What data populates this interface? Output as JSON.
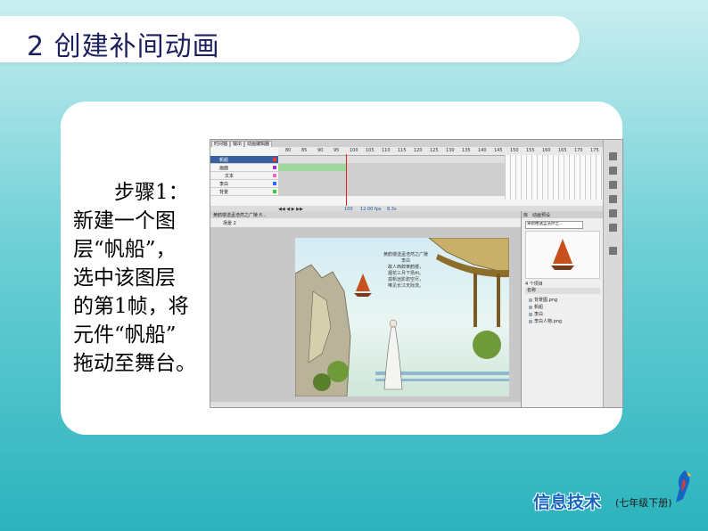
{
  "slide": {
    "title": "2 创建补间动画",
    "step_lines": [
      "步骤1：",
      "新建一个图",
      "层“帆船”，",
      "选中该图层",
      "的第1帧，将",
      "元件“帆船”",
      "拖动至舞台。"
    ]
  },
  "flash": {
    "timeline_tabs": [
      "时间轴",
      "输出",
      "动画编辑器"
    ],
    "ruler_marks": [
      "80",
      "85",
      "90",
      "95",
      "100",
      "105",
      "110",
      "115",
      "120",
      "125",
      "130",
      "135",
      "140",
      "145",
      "150",
      "155",
      "160",
      "165",
      "170",
      "175"
    ],
    "layers": [
      {
        "name": "帆船",
        "color": "#ff3333"
      },
      {
        "name": "画面",
        "color": "#9933cc"
      },
      {
        "name": "文本",
        "color": "#ff66cc"
      },
      {
        "name": "李白",
        "color": "#3366ff"
      },
      {
        "name": "背景",
        "color": "#33cc33"
      }
    ],
    "timeline_status": [
      "100",
      "12.00 fps",
      "8.3s"
    ],
    "document_tab": "黄鹤楼送孟浩然之广陵.fl...",
    "scene_label": "场景 2",
    "poem_lines": [
      "黄鹤楼送孟浩然之广陵",
      "李白",
      "故人西辞黄鹤楼，",
      "烟花三月下扬州。",
      "孤帆远影碧空尽，",
      "唯见长江天际流。"
    ],
    "panel_tabs": [
      "库",
      "动画预设"
    ],
    "library_select": "黄鹤楼送孟浩然之...",
    "library_count": "4 个项目",
    "library_header": "名称",
    "library_items": [
      "背景图.png",
      "帆船",
      "李白",
      "李白人物.png"
    ]
  },
  "branding": {
    "logo_title": "信息技术",
    "logo_subtitle": "(七年级下册)"
  },
  "colors": {
    "title_text": "#1b1f5e",
    "selected_layer": "#3a5fa0",
    "playhead": "#e02020",
    "logo_blue": "#1565c0"
  }
}
